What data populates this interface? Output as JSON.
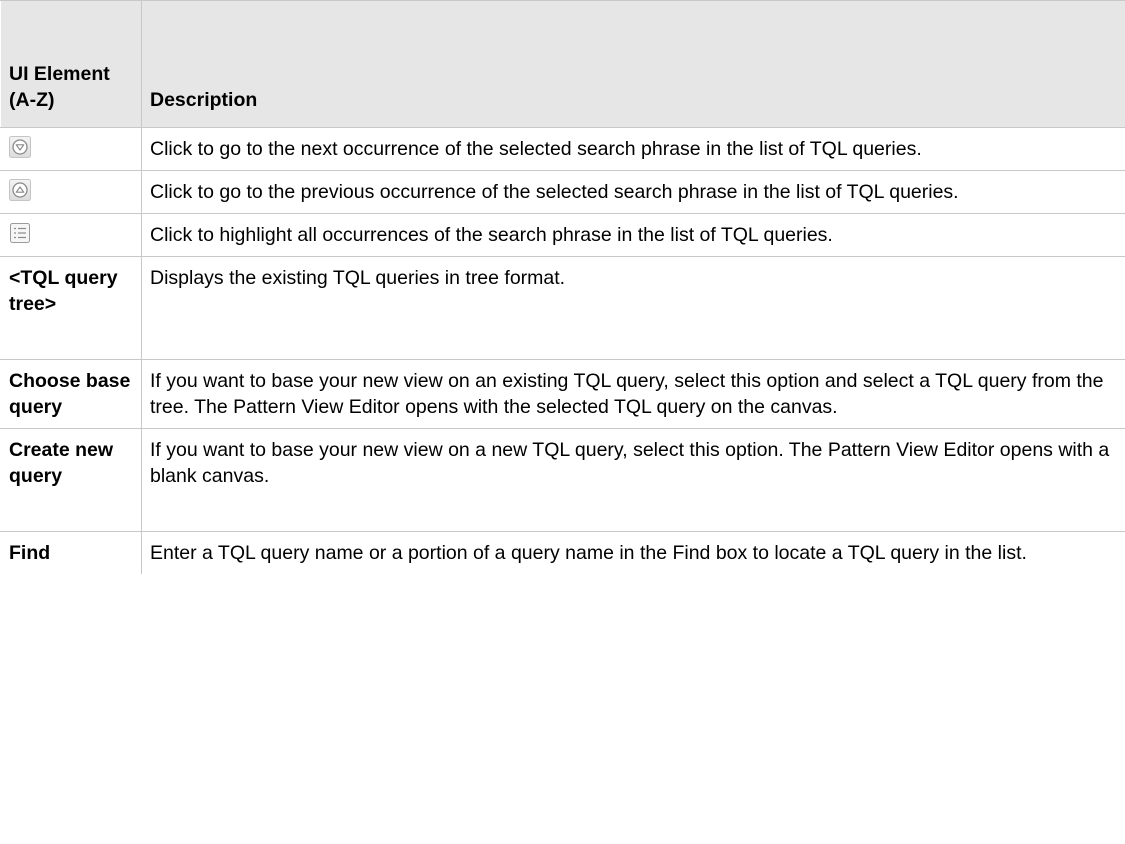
{
  "table": {
    "header": {
      "col1": "UI Element (A-Z)",
      "col2": "Description"
    },
    "rows": [
      {
        "icon": "next-occurrence-icon",
        "description": "Click to go to the next occurrence of the selected search phrase in the list of TQL queries."
      },
      {
        "icon": "previous-occurrence-icon",
        "description": "Click to go to the previous occurrence of the selected search phrase in the list of TQL queries."
      },
      {
        "icon": "highlight-all-icon",
        "description": "Click to highlight all occurrences of the search phrase in the list of TQL queries."
      },
      {
        "element": "<TQL query tree>",
        "description": "Displays the existing TQL queries in tree format."
      },
      {
        "element": "Choose base query",
        "description": "If you want to base your new view on an existing TQL query, select this option and select a TQL query from the tree. The Pattern View Editor opens with the selected TQL query on the canvas."
      },
      {
        "element": "Create new query",
        "description": "If you want to base your new view on a new TQL query, select this option. The Pattern View Editor opens with a blank canvas."
      },
      {
        "element": "Find",
        "description": "Enter a TQL query name or a portion of a query name in the Find box to locate a TQL query in the list."
      }
    ]
  }
}
